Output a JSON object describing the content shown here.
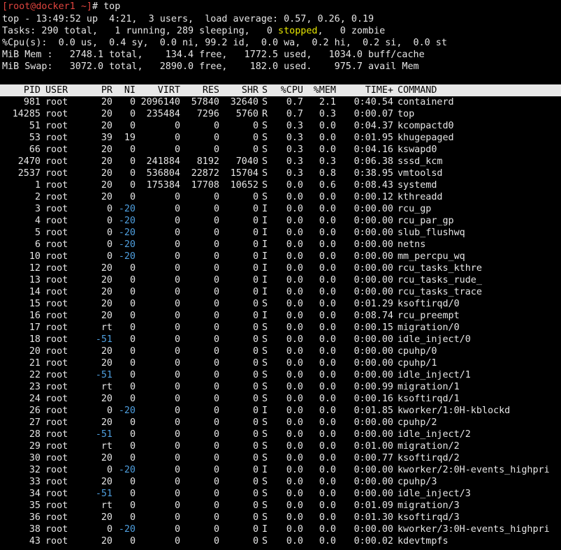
{
  "prompt": {
    "user_host": "[root@docker1 ~]",
    "symbol": "#",
    "command": " top"
  },
  "summary": {
    "line1": "top - 13:49:52 up  4:21,  3 users,  load average: 0.57, 0.26, 0.19",
    "tasks_a": "Tasks: 290 total,   1 running, 289 sleeping,   0 ",
    "tasks_stopped": "stopped",
    "tasks_b": ",   0 zombie",
    "cpu": "%Cpu(s):  0.0 us,  0.4 sy,  0.0 ni, 99.2 id,  0.0 wa,  0.2 hi,  0.2 si,  0.0 st",
    "mem": "MiB Mem :   2748.1 total,    134.4 free,   1772.5 used,   1034.0 buff/cache",
    "swap": "MiB Swap:   3072.0 total,   2890.0 free,    182.0 used.    975.7 avail Mem"
  },
  "columns": {
    "pid": "PID",
    "user": "USER",
    "pr": "PR",
    "ni": "NI",
    "virt": "VIRT",
    "res": "RES",
    "shr": "SHR",
    "s": "S",
    "cpu": "%CPU",
    "mem": "%MEM",
    "time": "TIME+",
    "cmd": "COMMAND"
  },
  "processes": [
    [
      "981",
      "root",
      "20",
      "0",
      "2096140",
      "57840",
      "32640",
      "S",
      "0.7",
      "2.1",
      "0:40.54",
      "containerd"
    ],
    [
      "14285",
      "root",
      "20",
      "0",
      "235484",
      "7296",
      "5760",
      "R",
      "0.7",
      "0.3",
      "0:00.07",
      "top"
    ],
    [
      "51",
      "root",
      "20",
      "0",
      "0",
      "0",
      "0",
      "S",
      "0.3",
      "0.0",
      "0:04.37",
      "kcompactd0"
    ],
    [
      "53",
      "root",
      "39",
      "19",
      "0",
      "0",
      "0",
      "S",
      "0.3",
      "0.0",
      "0:01.95",
      "khugepaged"
    ],
    [
      "66",
      "root",
      "20",
      "0",
      "0",
      "0",
      "0",
      "S",
      "0.3",
      "0.0",
      "0:04.16",
      "kswapd0"
    ],
    [
      "2470",
      "root",
      "20",
      "0",
      "241884",
      "8192",
      "7040",
      "S",
      "0.3",
      "0.3",
      "0:06.38",
      "sssd_kcm"
    ],
    [
      "2537",
      "root",
      "20",
      "0",
      "536804",
      "22872",
      "15704",
      "S",
      "0.3",
      "0.8",
      "0:38.95",
      "vmtoolsd"
    ],
    [
      "1",
      "root",
      "20",
      "0",
      "175384",
      "17708",
      "10652",
      "S",
      "0.0",
      "0.6",
      "0:08.43",
      "systemd"
    ],
    [
      "2",
      "root",
      "20",
      "0",
      "0",
      "0",
      "0",
      "S",
      "0.0",
      "0.0",
      "0:00.12",
      "kthreadd"
    ],
    [
      "3",
      "root",
      "0",
      "-20",
      "0",
      "0",
      "0",
      "I",
      "0.0",
      "0.0",
      "0:00.00",
      "rcu_gp"
    ],
    [
      "4",
      "root",
      "0",
      "-20",
      "0",
      "0",
      "0",
      "I",
      "0.0",
      "0.0",
      "0:00.00",
      "rcu_par_gp"
    ],
    [
      "5",
      "root",
      "0",
      "-20",
      "0",
      "0",
      "0",
      "I",
      "0.0",
      "0.0",
      "0:00.00",
      "slub_flushwq"
    ],
    [
      "6",
      "root",
      "0",
      "-20",
      "0",
      "0",
      "0",
      "I",
      "0.0",
      "0.0",
      "0:00.00",
      "netns"
    ],
    [
      "10",
      "root",
      "0",
      "-20",
      "0",
      "0",
      "0",
      "I",
      "0.0",
      "0.0",
      "0:00.00",
      "mm_percpu_wq"
    ],
    [
      "12",
      "root",
      "20",
      "0",
      "0",
      "0",
      "0",
      "I",
      "0.0",
      "0.0",
      "0:00.00",
      "rcu_tasks_kthre"
    ],
    [
      "13",
      "root",
      "20",
      "0",
      "0",
      "0",
      "0",
      "I",
      "0.0",
      "0.0",
      "0:00.00",
      "rcu_tasks_rude_"
    ],
    [
      "14",
      "root",
      "20",
      "0",
      "0",
      "0",
      "0",
      "I",
      "0.0",
      "0.0",
      "0:00.00",
      "rcu_tasks_trace"
    ],
    [
      "15",
      "root",
      "20",
      "0",
      "0",
      "0",
      "0",
      "S",
      "0.0",
      "0.0",
      "0:01.29",
      "ksoftirqd/0"
    ],
    [
      "16",
      "root",
      "20",
      "0",
      "0",
      "0",
      "0",
      "I",
      "0.0",
      "0.0",
      "0:08.74",
      "rcu_preempt"
    ],
    [
      "17",
      "root",
      "rt",
      "0",
      "0",
      "0",
      "0",
      "S",
      "0.0",
      "0.0",
      "0:00.15",
      "migration/0"
    ],
    [
      "18",
      "root",
      "-51",
      "0",
      "0",
      "0",
      "0",
      "S",
      "0.0",
      "0.0",
      "0:00.00",
      "idle_inject/0"
    ],
    [
      "20",
      "root",
      "20",
      "0",
      "0",
      "0",
      "0",
      "S",
      "0.0",
      "0.0",
      "0:00.00",
      "cpuhp/0"
    ],
    [
      "21",
      "root",
      "20",
      "0",
      "0",
      "0",
      "0",
      "S",
      "0.0",
      "0.0",
      "0:00.00",
      "cpuhp/1"
    ],
    [
      "22",
      "root",
      "-51",
      "0",
      "0",
      "0",
      "0",
      "S",
      "0.0",
      "0.0",
      "0:00.00",
      "idle_inject/1"
    ],
    [
      "23",
      "root",
      "rt",
      "0",
      "0",
      "0",
      "0",
      "S",
      "0.0",
      "0.0",
      "0:00.99",
      "migration/1"
    ],
    [
      "24",
      "root",
      "20",
      "0",
      "0",
      "0",
      "0",
      "S",
      "0.0",
      "0.0",
      "0:00.16",
      "ksoftirqd/1"
    ],
    [
      "26",
      "root",
      "0",
      "-20",
      "0",
      "0",
      "0",
      "I",
      "0.0",
      "0.0",
      "0:01.85",
      "kworker/1:0H-kblockd"
    ],
    [
      "27",
      "root",
      "20",
      "0",
      "0",
      "0",
      "0",
      "S",
      "0.0",
      "0.0",
      "0:00.00",
      "cpuhp/2"
    ],
    [
      "28",
      "root",
      "-51",
      "0",
      "0",
      "0",
      "0",
      "S",
      "0.0",
      "0.0",
      "0:00.00",
      "idle_inject/2"
    ],
    [
      "29",
      "root",
      "rt",
      "0",
      "0",
      "0",
      "0",
      "S",
      "0.0",
      "0.0",
      "0:01.00",
      "migration/2"
    ],
    [
      "30",
      "root",
      "20",
      "0",
      "0",
      "0",
      "0",
      "S",
      "0.0",
      "0.0",
      "0:00.77",
      "ksoftirqd/2"
    ],
    [
      "32",
      "root",
      "0",
      "-20",
      "0",
      "0",
      "0",
      "I",
      "0.0",
      "0.0",
      "0:00.00",
      "kworker/2:0H-events_highpri"
    ],
    [
      "33",
      "root",
      "20",
      "0",
      "0",
      "0",
      "0",
      "S",
      "0.0",
      "0.0",
      "0:00.00",
      "cpuhp/3"
    ],
    [
      "34",
      "root",
      "-51",
      "0",
      "0",
      "0",
      "0",
      "S",
      "0.0",
      "0.0",
      "0:00.00",
      "idle_inject/3"
    ],
    [
      "35",
      "root",
      "rt",
      "0",
      "0",
      "0",
      "0",
      "S",
      "0.0",
      "0.0",
      "0:01.09",
      "migration/3"
    ],
    [
      "36",
      "root",
      "20",
      "0",
      "0",
      "0",
      "0",
      "S",
      "0.0",
      "0.0",
      "0:01.30",
      "ksoftirqd/3"
    ],
    [
      "38",
      "root",
      "0",
      "-20",
      "0",
      "0",
      "0",
      "I",
      "0.0",
      "0.0",
      "0:00.00",
      "kworker/3:0H-events_highpri"
    ],
    [
      "43",
      "root",
      "20",
      "0",
      "0",
      "0",
      "0",
      "S",
      "0.0",
      "0.0",
      "0:00.02",
      "kdevtmpfs"
    ]
  ],
  "colors": {
    "background": "#000000",
    "text": "#e6e6e6",
    "prompt": "#e0443e",
    "stopped": "#e6e600",
    "priority_highlight": "#4f9fdf",
    "header_bar": "#e8e8e8"
  }
}
